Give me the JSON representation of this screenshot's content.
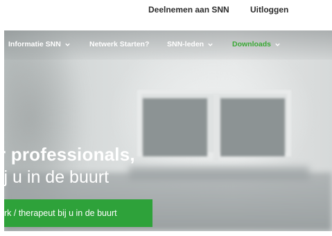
{
  "topbar": {
    "join_label": "Deelnemen aan SNN",
    "logout_label": "Uitloggen"
  },
  "nav": {
    "items": [
      {
        "label": "Informatie SNN",
        "has_dropdown": true
      },
      {
        "label": "Netwerk Starten?",
        "has_dropdown": false
      },
      {
        "label": "SNN-leden",
        "has_dropdown": true
      },
      {
        "label": "Downloads",
        "has_dropdown": true,
        "active": true
      }
    ]
  },
  "hero": {
    "headline": "r professionals,",
    "subline": "ij u in de buurt",
    "cta_label": "rk / therapeut bij u in de buurt"
  },
  "colors": {
    "accent_green": "#2ea23a",
    "nav_active": "#3aa935",
    "text_dark": "#2b2b2b"
  }
}
